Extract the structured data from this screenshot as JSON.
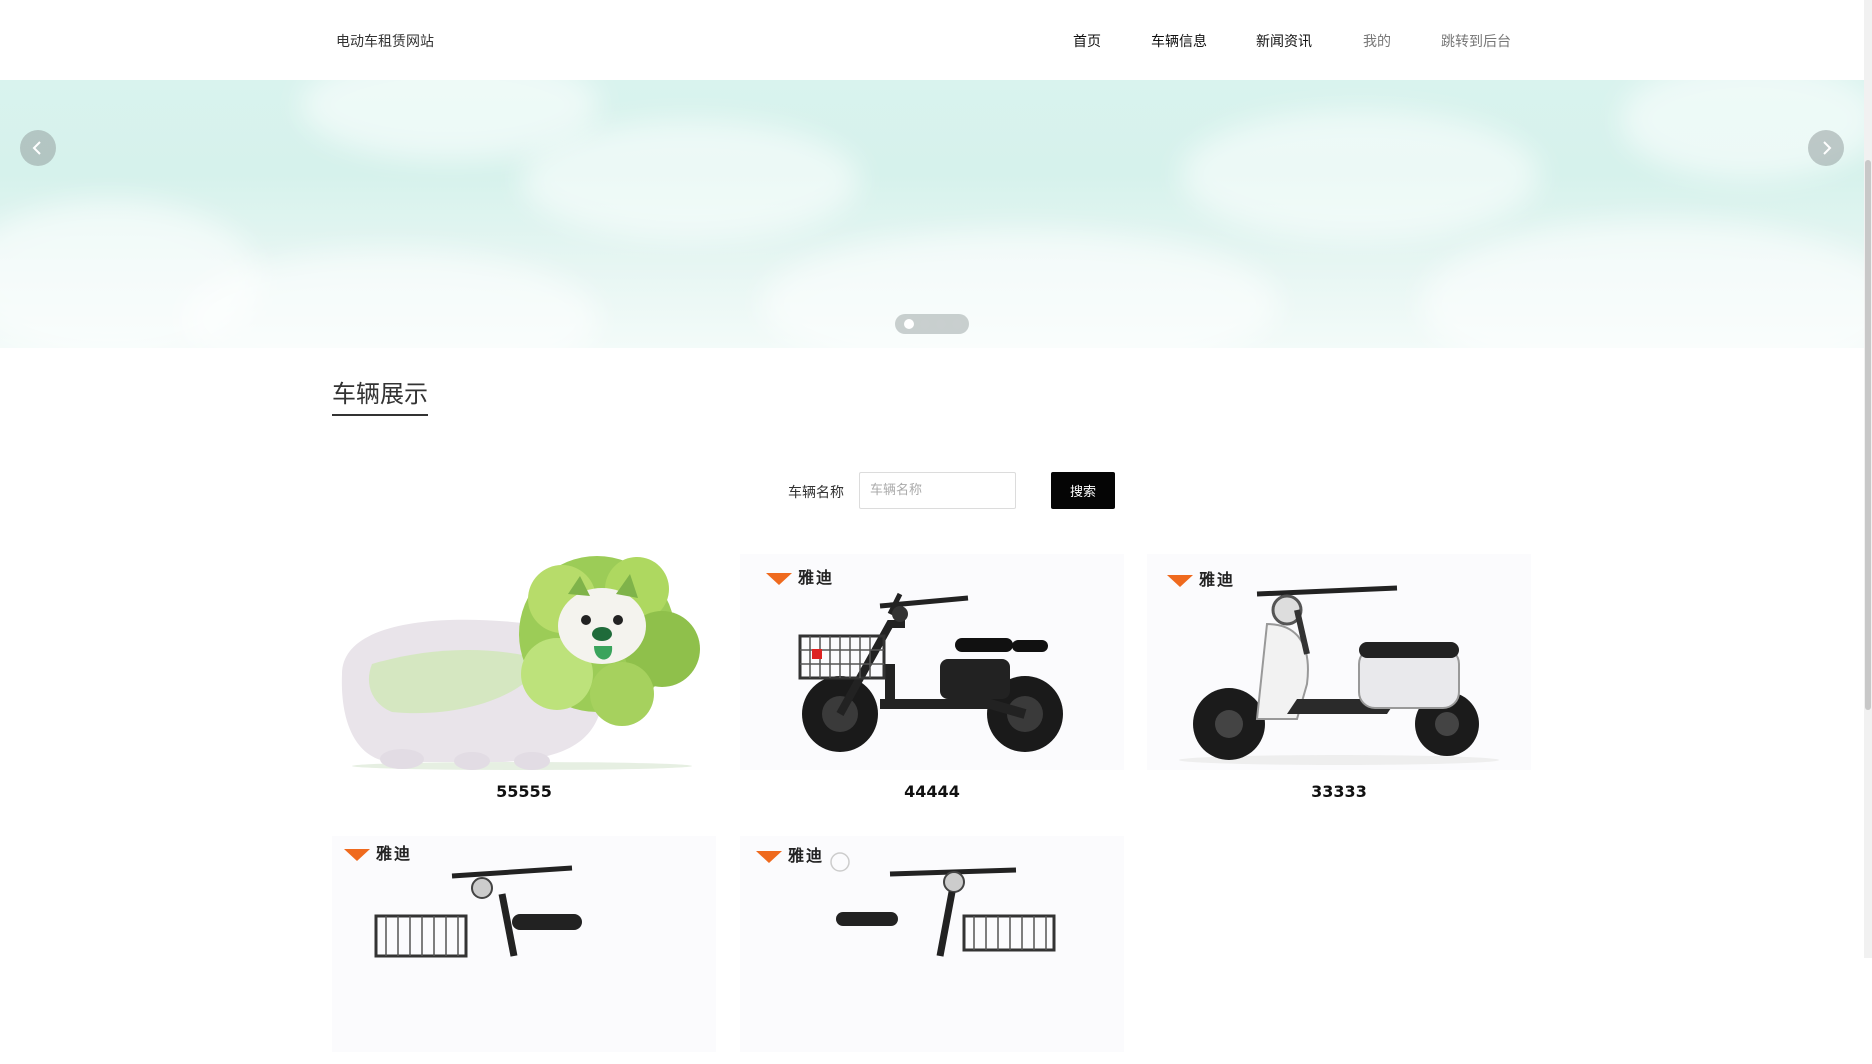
{
  "header": {
    "site_title": "电动车租赁网站",
    "nav": [
      {
        "label": "首页",
        "state": "normal"
      },
      {
        "label": "车辆信息",
        "state": "normal"
      },
      {
        "label": "新闻资讯",
        "state": "normal"
      },
      {
        "label": "我的",
        "state": "muted"
      },
      {
        "label": "跳转到后台",
        "state": "muted"
      }
    ]
  },
  "banner": {
    "slide_count": 4,
    "active_slide": 1,
    "prev_icon": "chevron-left-icon",
    "next_icon": "chevron-right-icon"
  },
  "section": {
    "title": "车辆展示"
  },
  "search": {
    "label": "车辆名称",
    "placeholder": "车辆名称",
    "value": "",
    "button_label": "搜索"
  },
  "brand_text": "雅迪",
  "products": [
    {
      "name": "55555",
      "image": "cabbage-dog"
    },
    {
      "name": "44444",
      "image": "black-ebike-with-basket"
    },
    {
      "name": "33333",
      "image": "white-scooter"
    },
    {
      "name": "",
      "image": "black-ebike-with-basket"
    },
    {
      "name": "",
      "image": "black-ebike-with-basket"
    }
  ],
  "colors": {
    "accent_button": "#050505",
    "brand_orange": "#ef6a1e",
    "banner_sky": "#d9f3ee"
  }
}
